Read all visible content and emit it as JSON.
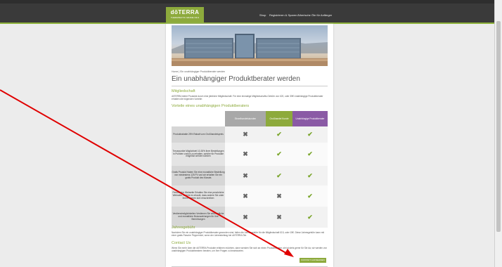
{
  "header": {
    "logo_brand": "dōTERRA",
    "logo_sub": "THERAPEUTIC GRADE OILS",
    "nav": [
      "Shop",
      "Registrieren & Sparen",
      "Ätherische Öle für Anfänger"
    ]
  },
  "breadcrumb": "Home | Ein unabhängiger Produktberater werden",
  "page_title": "Ein unabhängiger Produktberater werden",
  "membership": {
    "heading": "Mitgliedschaft",
    "text": "dōTERRA bietet Produkte durch eine jährliche Mitgliedschaft. Für eine einmalige Mitgliedschafts-Gebühr von £20, oder 35€ Unabhängige Produktberater erhalten die folgenden Vorteile:"
  },
  "benefits_heading": "Vorteile eines unabhängigen Produktberaters",
  "table": {
    "headers": [
      "Einzelhandelskunden",
      "Großhandel Kunde",
      "Unabhängige Produktberater"
    ],
    "rows": [
      {
        "label": "Produktrabatte 25% Rabatt vom Großhandelspreis",
        "cells": [
          "x",
          "ok",
          "ok"
        ]
      },
      {
        "label": "Treuepunkte Möglichkeit 10-30% ihrer Bestellungen in Punkten zurück zu erhalten, welche für Produkte eingelöst werden können",
        "cells": [
          "x",
          "ok",
          "ok"
        ]
      },
      {
        "label": "Gratis Produkt Haben Sie eine monatliche Bestellung von mindestens 125 PV und wir erhalten Sie ein gratis Produkt des Monats",
        "cells": [
          "x",
          "ok",
          "ok"
        ]
      },
      {
        "label": "Persönliche Webseite Erhalten Sie eine persönliche Webseite, welche es erlaubt, dass andere Sie unter Ihrem Namen sich einschreiben",
        "cells": [
          "x",
          "x",
          "ok"
        ]
      },
      {
        "label": "Verdienstmöglichkeiten Verdienen Sie wöchentliche und monatliche Bonuszahlungen für Ihre Bemühungen",
        "cells": [
          "x",
          "x",
          "ok"
        ]
      }
    ]
  },
  "annual_fee": {
    "heading": "Jahresgebühr",
    "text": "Nachdem Sie ein unabhängiger Produktberater geworden sind, fallen die Jahresgebühr für die Mitgliedschaft £15, oder 15€. Diese Jahresgebühr kann mit einer gratis Flasche Peppermint, wenn der Jahresbeitrag bei dōTERRA Öle."
  },
  "contact": {
    "heading": "Contact Us",
    "text": "Wenn Sie mehr über die dōTERRA Produkte erfahren möchten, dann wenden Sie sich an einen Produktberater, sie ist stets gerne für Sie da, wir werden von unabhängigen Produktberatern beraten, um Ihre Fragen zu beantworten."
  },
  "cta_label": "KONTAKT AUFNEHMEN",
  "colors": {
    "accent_green": "#8daa3c",
    "accent_purple": "#8a5aa5",
    "annotation_red": "#e00000"
  }
}
